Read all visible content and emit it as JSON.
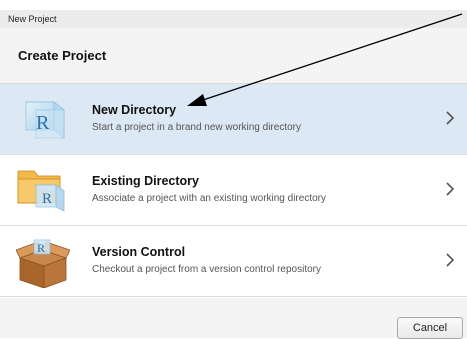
{
  "window": {
    "title": "New Project"
  },
  "header": {
    "title": "Create Project"
  },
  "options": [
    {
      "title": "New Directory",
      "description": "Start a project in a brand new working directory",
      "icon": "new-directory-icon",
      "selected": true
    },
    {
      "title": "Existing Directory",
      "description": "Associate a project with an existing working directory",
      "icon": "existing-directory-icon",
      "selected": false
    },
    {
      "title": "Version Control",
      "description": "Checkout a project from a version control repository",
      "icon": "version-control-icon",
      "selected": false
    }
  ],
  "footer": {
    "cancel_label": "Cancel"
  },
  "colors": {
    "selected_row": "#dde8f5",
    "header_bg": "#f4f4f4",
    "arrow": "#000000"
  }
}
